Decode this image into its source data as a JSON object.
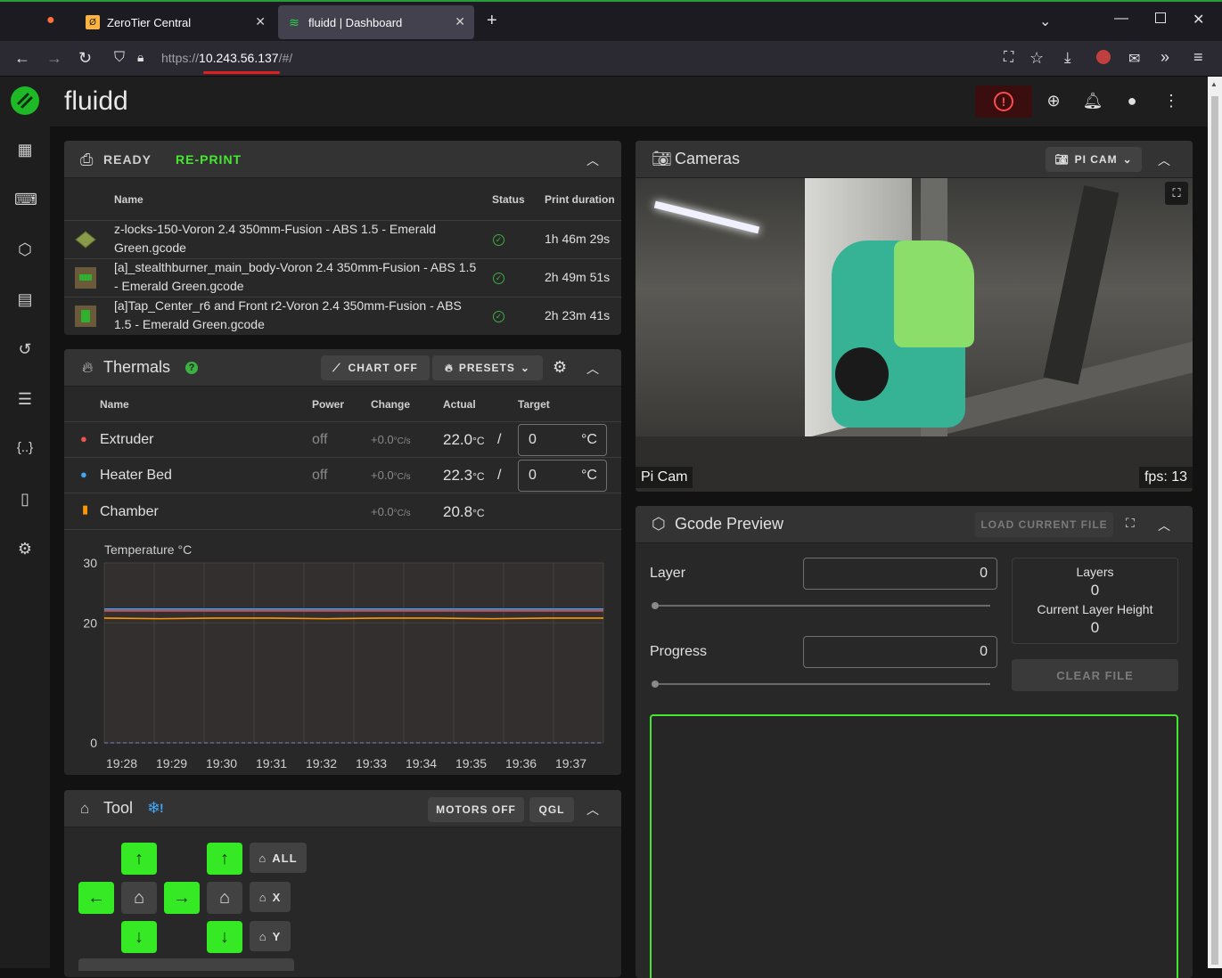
{
  "browser": {
    "tabs": [
      {
        "title": "ZeroTier Central"
      },
      {
        "title": "fluidd | Dashboard"
      }
    ],
    "url_prefix": "https://",
    "url_host": "10.243.56.137",
    "url_path": "/#/"
  },
  "app": {
    "brand": "fluidd"
  },
  "status_card": {
    "status": "READY",
    "reprint": "RE-PRINT",
    "columns": [
      "Name",
      "Status",
      "Print duration"
    ],
    "rows": [
      {
        "name": "z-locks-150-Voron 2.4 350mm-Fusion - ABS 1.5 - Emerald Green.gcode",
        "duration": "1h 46m 29s"
      },
      {
        "name": "[a]_stealthburner_main_body-Voron 2.4 350mm-Fusion - ABS 1.5 - Emerald Green.gcode",
        "duration": "2h 49m 51s"
      },
      {
        "name": "[a]Tap_Center_r6 and Front r2-Voron 2.4 350mm-Fusion - ABS 1.5 - Emerald Green.gcode",
        "duration": "2h 23m 41s"
      }
    ]
  },
  "thermals": {
    "title": "Thermals",
    "chart_off": "CHART OFF",
    "presets": "PRESETS",
    "columns": [
      "Name",
      "Power",
      "Change",
      "Actual",
      "Target"
    ],
    "rows": [
      {
        "name": "Extruder",
        "power": "off",
        "change": "+0.0",
        "change_unit": "°C/s",
        "actual": "22.0",
        "actual_unit": "°C",
        "target": "0",
        "target_unit": "°C"
      },
      {
        "name": "Heater Bed",
        "power": "off",
        "change": "+0.0",
        "change_unit": "°C/s",
        "actual": "22.3",
        "actual_unit": "°C",
        "target": "0",
        "target_unit": "°C"
      },
      {
        "name": "Chamber",
        "power": "",
        "change": "+0.0",
        "change_unit": "°C/s",
        "actual": "20.8",
        "actual_unit": "°C",
        "target": "",
        "target_unit": ""
      }
    ],
    "slash": "/"
  },
  "chart_data": {
    "type": "line",
    "title": "",
    "ylabel": "Temperature °C",
    "xlabel": "",
    "ylim": [
      0,
      30
    ],
    "yticks": [
      "30",
      "20",
      "0"
    ],
    "x": [
      "19:28",
      "19:29",
      "19:30",
      "19:31",
      "19:32",
      "19:33",
      "19:34",
      "19:35",
      "19:36",
      "19:37"
    ],
    "series": [
      {
        "values": [
          22.3,
          22.3,
          22.3,
          22.3,
          22.3,
          22.3,
          22.3,
          22.3,
          22.3,
          22.3
        ],
        "color": "#42a5f5"
      },
      {
        "values": [
          22.0,
          22.0,
          22.0,
          22.0,
          22.0,
          22.0,
          22.0,
          22.0,
          22.0,
          22.0
        ],
        "color": "#ef5350"
      },
      {
        "values": [
          20.8,
          20.7,
          20.8,
          20.8,
          20.7,
          20.8,
          20.8,
          20.7,
          20.8,
          20.8
        ],
        "color": "#ff9800"
      },
      {
        "values": [
          0,
          0,
          0,
          0,
          0,
          0,
          0,
          0,
          0,
          0
        ],
        "color": "#7986cb"
      }
    ],
    "grid": true
  },
  "tool": {
    "title": "Tool",
    "motors_off": "MOTORS OFF",
    "qgl": "QGL",
    "home_all": "ALL",
    "home_x": "X",
    "home_y": "Y"
  },
  "cameras": {
    "title": "Cameras",
    "selector": "PI CAM",
    "cam_label": "Pi Cam",
    "fps": "fps: 13"
  },
  "gcode_preview": {
    "title": "Gcode Preview",
    "load_current": "LOAD CURRENT FILE",
    "layer_label": "Layer",
    "layer_value": "0",
    "progress_label": "Progress",
    "progress_value": "0",
    "layers_label": "Layers",
    "layers_value": "0",
    "clh_label": "Current Layer Height",
    "clh_value": "0",
    "clear_file": "CLEAR FILE"
  },
  "colors": {
    "accent": "#44e830",
    "estop": "#ff4b4b"
  }
}
